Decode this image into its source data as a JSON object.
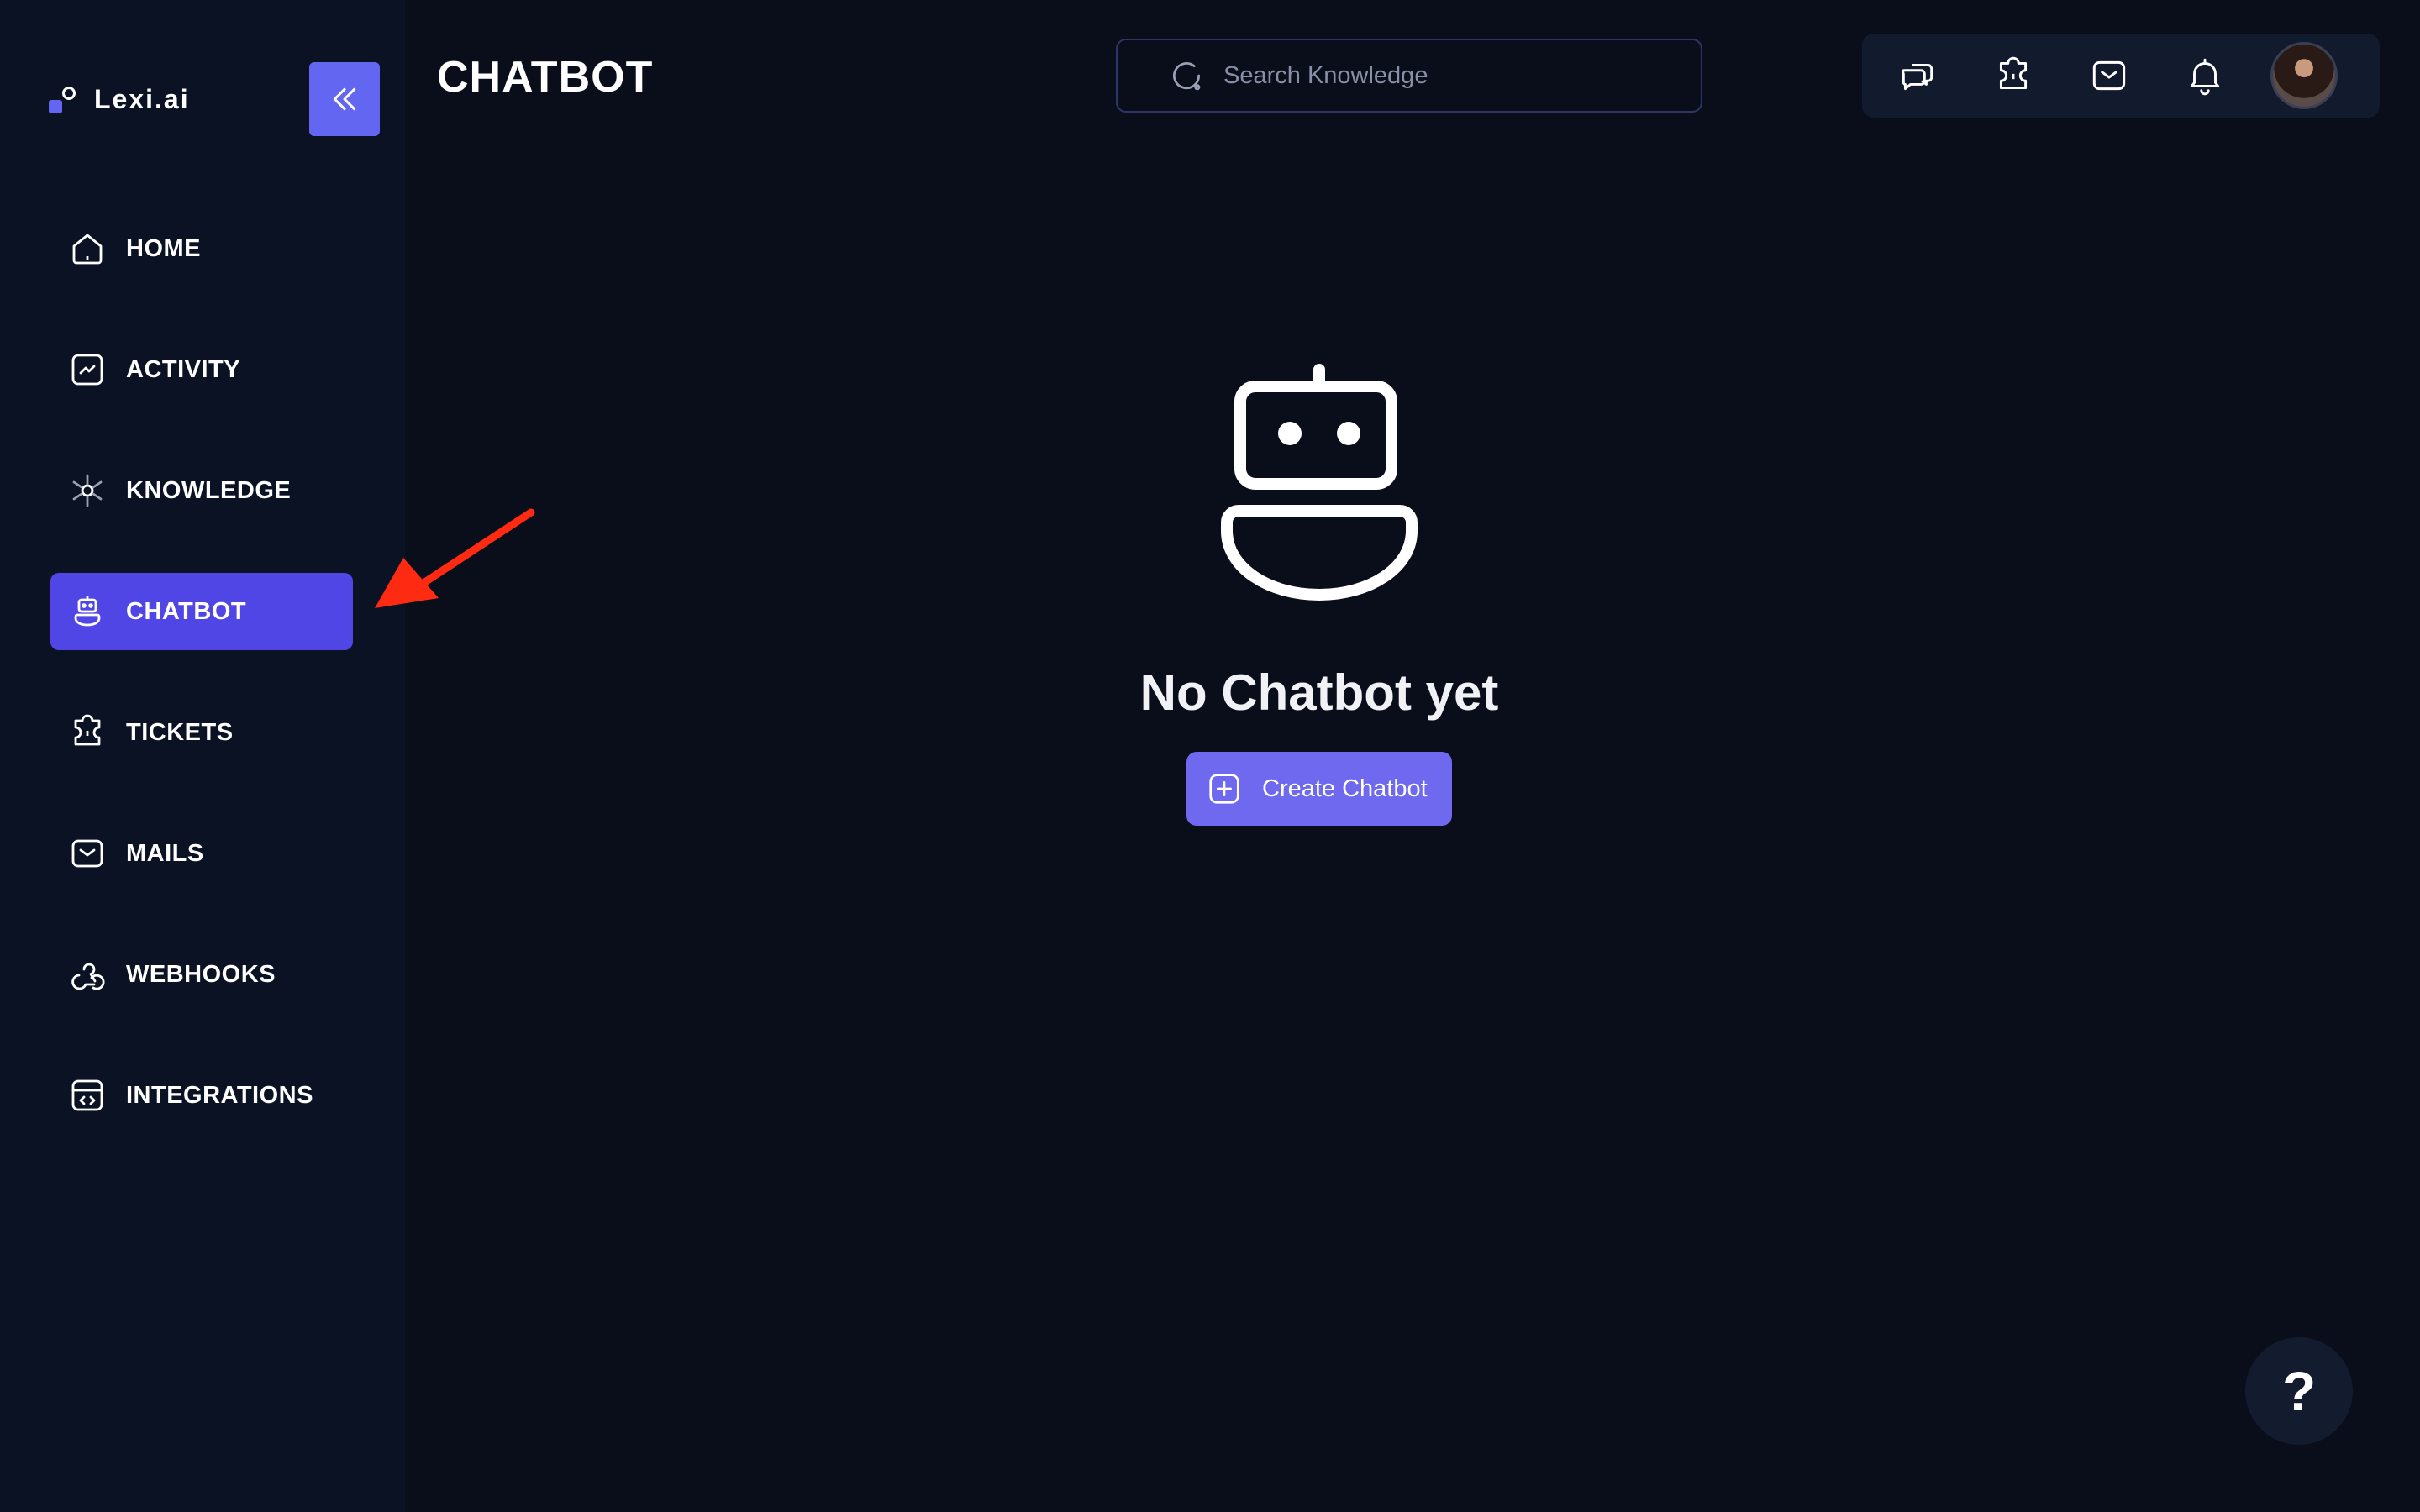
{
  "app": {
    "name": "Lexi.ai"
  },
  "header": {
    "title": "CHATBOT",
    "search_placeholder": "Search Knowledge"
  },
  "topbar": {
    "icons": [
      "chat-bubbles-icon",
      "ticket-icon",
      "mail-icon",
      "bell-icon"
    ],
    "avatar": "user-avatar"
  },
  "sidebar": {
    "items": [
      {
        "label": "HOME",
        "icon": "home-icon"
      },
      {
        "label": "ACTIVITY",
        "icon": "activity-chart-icon"
      },
      {
        "label": "KNOWLEDGE",
        "icon": "knowledge-network-icon"
      },
      {
        "label": "CHATBOT",
        "icon": "robot-icon",
        "active": true
      },
      {
        "label": "TICKETS",
        "icon": "ticket-icon"
      },
      {
        "label": "MAILS",
        "icon": "mail-icon"
      },
      {
        "label": "WEBHOOKS",
        "icon": "webhook-icon"
      },
      {
        "label": "INTEGRATIONS",
        "icon": "integration-code-icon"
      }
    ]
  },
  "main": {
    "empty_state": {
      "title": "No Chatbot yet",
      "button_label": "Create Chatbot"
    }
  },
  "help": {
    "label": "?"
  },
  "colors": {
    "background": "#0a0e1a",
    "sidebar": "#0b1224",
    "accent": "#6366f1",
    "active_nav": "#4f46e5",
    "annotation_arrow": "#ff2a12"
  }
}
